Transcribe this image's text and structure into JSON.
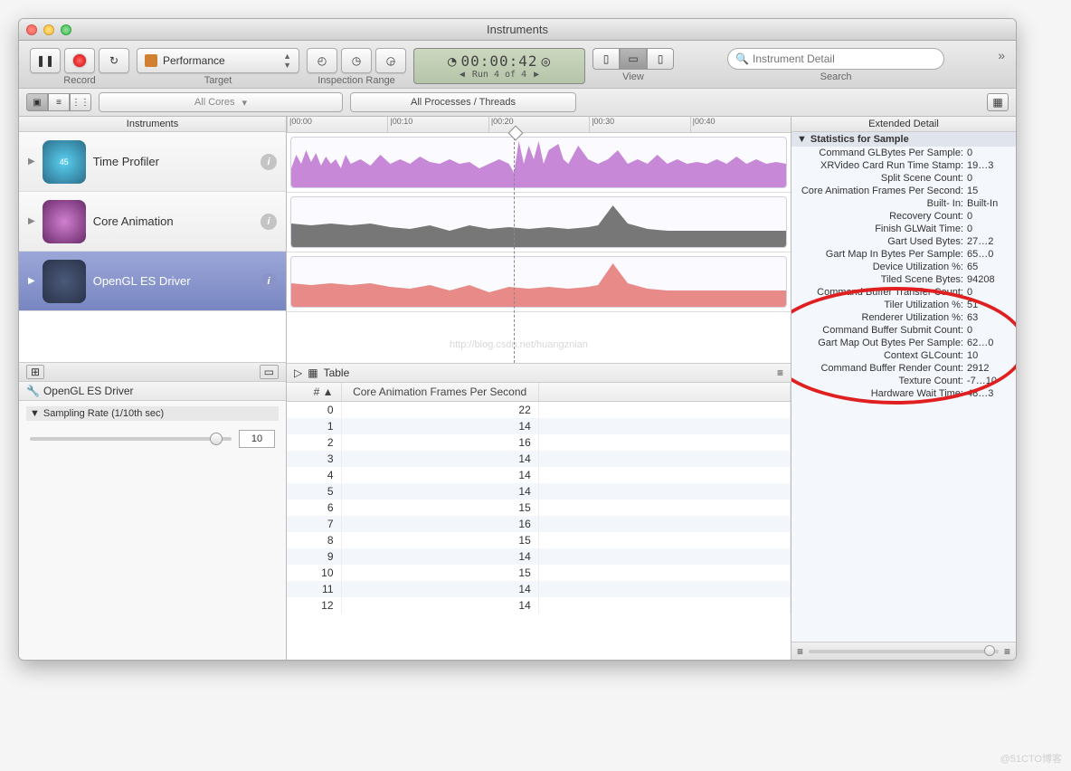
{
  "window_title": "Instruments",
  "toolbar": {
    "record_label": "Record",
    "target_label": "Target",
    "target_value": "Performance",
    "inspection_label": "Inspection Range",
    "timer": "00:00:42",
    "run_text": "Run 4 of 4",
    "view_label": "View",
    "search_label": "Search",
    "search_placeholder": "Instrument Detail"
  },
  "subtoolbar": {
    "cores_filter": "All Cores",
    "threads_filter": "All Processes / Threads"
  },
  "instruments_header": "Instruments",
  "instruments": [
    {
      "name": "Time Profiler"
    },
    {
      "name": "Core Animation"
    },
    {
      "name": "OpenGL ES Driver"
    }
  ],
  "timeline_ticks": [
    "|00:00",
    "|00:10",
    "|00:20",
    "|00:30",
    "|00:40"
  ],
  "detail_selector": "OpenGL ES Driver",
  "sampling_title": "Sampling Rate (1/10th sec)",
  "sampling_value": "10",
  "table_label": "Table",
  "table": {
    "col1": "#",
    "col2": "Core Animation Frames Per Second",
    "rows": [
      {
        "i": "0",
        "v": "22"
      },
      {
        "i": "1",
        "v": "14"
      },
      {
        "i": "2",
        "v": "16"
      },
      {
        "i": "3",
        "v": "14"
      },
      {
        "i": "4",
        "v": "14"
      },
      {
        "i": "5",
        "v": "14"
      },
      {
        "i": "6",
        "v": "15"
      },
      {
        "i": "7",
        "v": "16"
      },
      {
        "i": "8",
        "v": "15"
      },
      {
        "i": "9",
        "v": "14"
      },
      {
        "i": "10",
        "v": "15"
      },
      {
        "i": "11",
        "v": "14"
      },
      {
        "i": "12",
        "v": "14"
      }
    ]
  },
  "extended_header": "Extended Detail",
  "stats_header": "Statistics for Sample",
  "stats": [
    {
      "l": "Command GLBytes Per Sample:",
      "v": "0"
    },
    {
      "l": "XRVideo Card Run Time Stamp:",
      "v": "19…3"
    },
    {
      "l": "Split Scene Count:",
      "v": "0"
    },
    {
      "l": "Core Animation Frames Per Second:",
      "v": "15"
    },
    {
      "l": "Built- In:",
      "v": "Built-In"
    },
    {
      "l": "Recovery Count:",
      "v": "0"
    },
    {
      "l": "Finish GLWait Time:",
      "v": "0"
    },
    {
      "l": "Gart Used Bytes:",
      "v": "27…2"
    },
    {
      "l": "Gart Map In Bytes Per Sample:",
      "v": "65…0"
    },
    {
      "l": "Device  Utilization %:",
      "v": "65"
    },
    {
      "l": "Tiled Scene Bytes:",
      "v": "94208"
    },
    {
      "l": "Command Buffer Transfer Count:",
      "v": "0"
    },
    {
      "l": "Tiler  Utilization %:",
      "v": "51"
    },
    {
      "l": "Renderer  Utilization %:",
      "v": "63"
    },
    {
      "l": "Command Buffer Submit Count:",
      "v": "0"
    },
    {
      "l": "Gart Map Out Bytes Per Sample:",
      "v": "62…0"
    },
    {
      "l": "Context GLCount:",
      "v": "10"
    },
    {
      "l": "Command Buffer Render Count:",
      "v": "2912"
    },
    {
      "l": "Texture Count:",
      "v": "-7…10"
    },
    {
      "l": "Hardware Wait Time:",
      "v": "48…3"
    }
  ],
  "watermark_url": "http://blog.csdn.net/huangznian",
  "footer_watermark": "@51CTO博客"
}
